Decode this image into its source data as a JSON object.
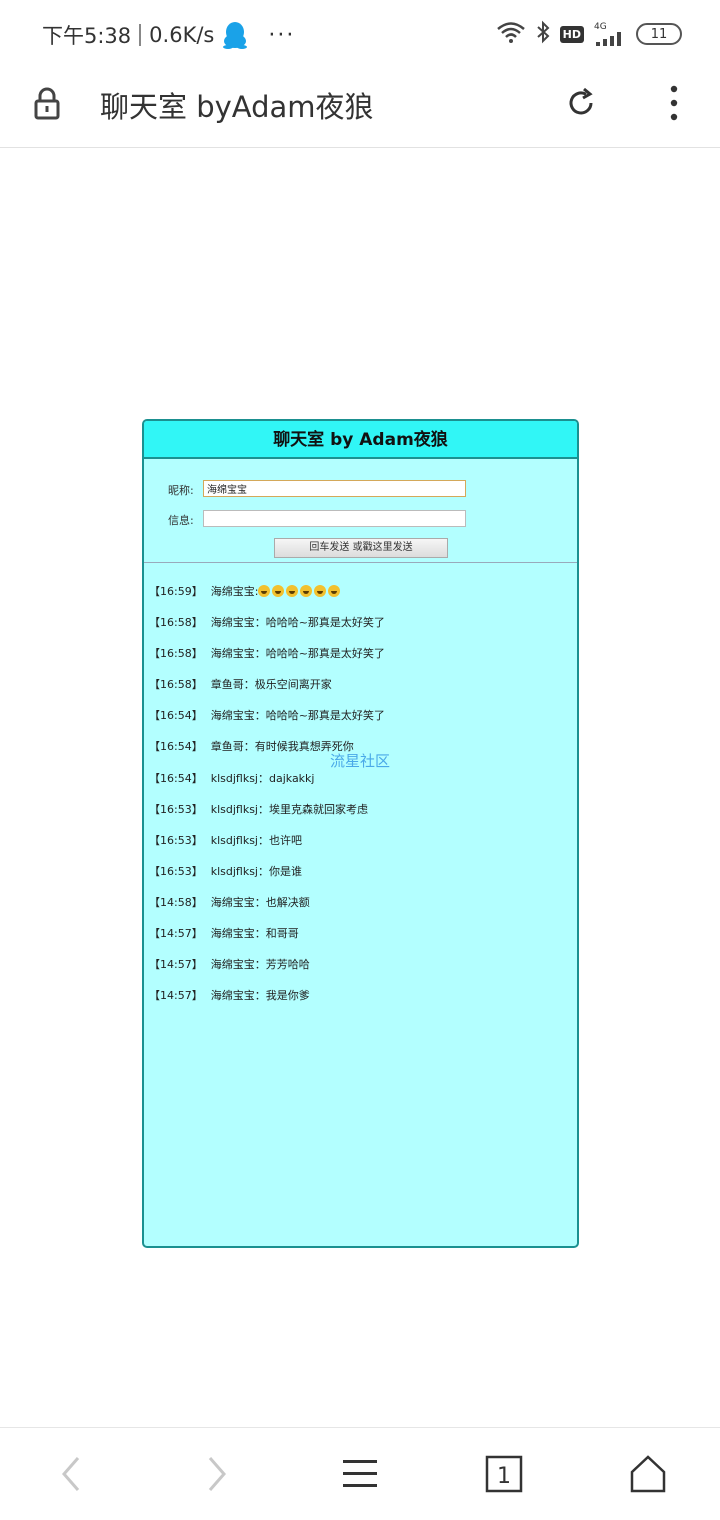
{
  "status_bar": {
    "time": "下午5:38",
    "speed": "0.6K/s",
    "more": "···",
    "hd": "HD",
    "network": "4G",
    "battery": "11"
  },
  "browser": {
    "title": "聊天室 byAdam夜狼",
    "tab_count": "1"
  },
  "chat": {
    "header": "聊天室 by Adam夜狼",
    "nickname_label": "昵称:",
    "nickname_value": "海绵宝宝",
    "message_label": "信息:",
    "message_value": "",
    "send_button": "回车发送 或戳这里发送",
    "watermark": "流星社区",
    "messages": [
      {
        "time": "【16:59】",
        "text": "海绵宝宝:",
        "emoji_count": 6
      },
      {
        "time": "【16:58】",
        "text": "海绵宝宝：哈哈哈~那真是太好笑了"
      },
      {
        "time": "【16:58】",
        "text": "海绵宝宝：哈哈哈~那真是太好笑了"
      },
      {
        "time": "【16:58】",
        "text": "章鱼哥：极乐空间离开家"
      },
      {
        "time": "【16:54】",
        "text": "海绵宝宝：哈哈哈~那真是太好笑了"
      },
      {
        "time": "【16:54】",
        "text": "章鱼哥：有时候我真想弄死你"
      },
      {
        "time": "【16:54】",
        "text": "klsdjflksj：dajkakkj"
      },
      {
        "time": "【16:53】",
        "text": "klsdjflksj：埃里克森就回家考虑"
      },
      {
        "time": "【16:53】",
        "text": "klsdjflksj：也许吧"
      },
      {
        "time": "【16:53】",
        "text": "klsdjflksj：你是谁"
      },
      {
        "time": "【14:58】",
        "text": "海绵宝宝：也解决额"
      },
      {
        "time": "【14:57】",
        "text": "海绵宝宝：和哥哥"
      },
      {
        "time": "【14:57】",
        "text": "海绵宝宝：芳芳哈哈"
      },
      {
        "time": "【14:57】",
        "text": "海绵宝宝：我是你爹"
      }
    ]
  }
}
